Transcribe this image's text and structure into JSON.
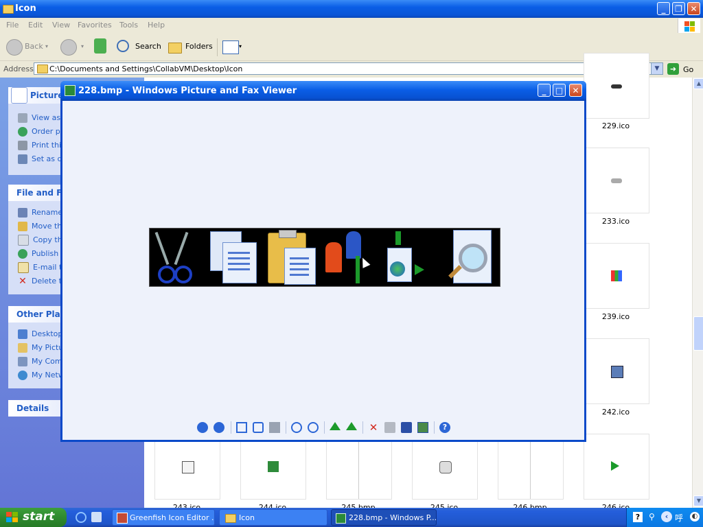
{
  "explorer": {
    "title": "Icon",
    "menu": [
      "File",
      "Edit",
      "View",
      "Favorites",
      "Tools",
      "Help"
    ],
    "toolbar": {
      "back": "Back",
      "search": "Search",
      "folders": "Folders"
    },
    "address_label": "Address",
    "address_value": "C:\\Documents and Settings\\CollabVM\\Desktop\\Icon",
    "go_label": "Go"
  },
  "taskpane": {
    "picture_tasks": {
      "title": "Picture",
      "items": [
        "View as",
        "Order pr",
        "Print this",
        "Set as d"
      ]
    },
    "file_folder_tasks": {
      "title": "File and Fol",
      "items": [
        "Rename",
        "Move th",
        "Copy thi",
        "Publish t",
        "E-mail th",
        "Delete th"
      ]
    },
    "other_places": {
      "title": "Other Place",
      "items": [
        "Desktop",
        "My Pictu",
        "My Comp",
        "My Netw"
      ]
    },
    "details": {
      "title": "Details"
    }
  },
  "files": {
    "right_column": [
      "229.ico",
      "233.ico",
      "239.ico",
      "242.ico"
    ],
    "bottom_row": [
      "243.ico",
      "244.ico",
      "245.bmp",
      "245.ico",
      "246.bmp",
      "246.ico"
    ]
  },
  "viewer": {
    "title": "228.bmp - Windows Picture and Fax Viewer",
    "tools": [
      "previous-image",
      "next-image",
      "best-fit",
      "actual-size",
      "slideshow",
      "zoom-in",
      "zoom-out",
      "rotate-clockwise",
      "rotate-counterclockwise",
      "delete",
      "print",
      "save",
      "edit",
      "help"
    ]
  },
  "taskbar": {
    "start_label": "start",
    "buttons": [
      "Greenfish Icon Editor ...",
      "Icon",
      "228.bmp - Windows P..."
    ],
    "tray_text": "呼"
  }
}
